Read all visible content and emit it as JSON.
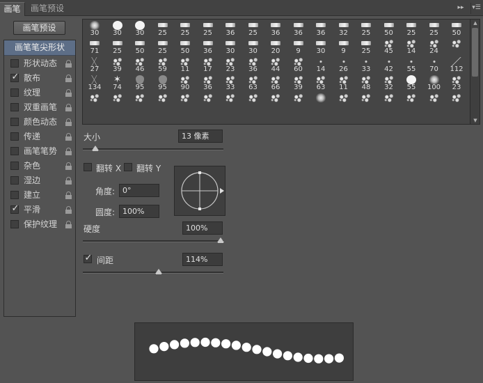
{
  "tabs": [
    {
      "label": "画笔",
      "active": true
    },
    {
      "label": "画笔预设",
      "active": false
    }
  ],
  "panel_controls": {
    "collapse_icon": "double-chevron-right-icon",
    "menu_icon": "panel-menu-icon"
  },
  "preset_button": {
    "label": "画笔预设"
  },
  "sidebar": {
    "header": "画笔笔尖形状",
    "items": [
      {
        "label": "形状动态",
        "checked": false
      },
      {
        "label": "散布",
        "checked": true
      },
      {
        "label": "纹理",
        "checked": false
      },
      {
        "label": "双重画笔",
        "checked": false
      },
      {
        "label": "颜色动态",
        "checked": false
      },
      {
        "label": "传递",
        "checked": false
      },
      {
        "label": "画笔笔势",
        "checked": false
      },
      {
        "label": "杂色",
        "checked": false
      },
      {
        "label": "湿边",
        "checked": false
      },
      {
        "label": "建立",
        "checked": false
      },
      {
        "label": "平滑",
        "checked": true
      },
      {
        "label": "保护纹理",
        "checked": false
      }
    ]
  },
  "brush_grid": {
    "rows": [
      [
        "30",
        "30",
        "30",
        "25",
        "25",
        "25",
        "36",
        "25",
        "36",
        "36",
        "36",
        "32",
        "25",
        "50",
        "25",
        "25",
        "50"
      ],
      [
        "71",
        "25",
        "50",
        "25",
        "50",
        "36",
        "30",
        "30",
        "20",
        "9",
        "30",
        "9",
        "25",
        "45",
        "14",
        "24",
        ""
      ],
      [
        "27",
        "39",
        "46",
        "59",
        "11",
        "17",
        "23",
        "36",
        "44",
        "60",
        "14",
        "26",
        "33",
        "42",
        "55",
        "70",
        "112"
      ],
      [
        "134",
        "74",
        "95",
        "95",
        "90",
        "36",
        "33",
        "63",
        "66",
        "39",
        "63",
        "11",
        "48",
        "32",
        "55",
        "100",
        "23"
      ],
      [
        "",
        "",
        "",
        "",
        "",
        "",
        "",
        "",
        "",
        "",
        "",
        "",
        "",
        "",
        "",
        "",
        ""
      ]
    ],
    "tip_styles": [
      [
        "soft",
        "hard",
        "hard",
        "chisel",
        "chisel",
        "chisel",
        "chisel",
        "chisel",
        "chisel",
        "chisel",
        "chisel",
        "chisel",
        "chisel",
        "chisel",
        "chisel",
        "chisel",
        "chisel"
      ],
      [
        "chisel",
        "chisel",
        "chisel",
        "chisel",
        "chisel",
        "chisel",
        "chisel",
        "chisel",
        "chisel",
        "chisel",
        "chisel",
        "chisel",
        "chisel",
        "spatter",
        "spatter",
        "spatter",
        "spatter"
      ],
      [
        "grass",
        "spatter",
        "spatter",
        "spatter",
        "spatter",
        "spatter",
        "spatter",
        "spatter",
        "spatter",
        "spatter",
        "dot",
        "dot",
        "dot",
        "dot",
        "dot",
        "dot",
        "stroke"
      ],
      [
        "grass",
        "star",
        "leaf",
        "leaf",
        "spatter",
        "spatter",
        "spatter",
        "spatter",
        "spatter",
        "spatter",
        "spatter",
        "spatter",
        "spatter",
        "spatter",
        "hard",
        "soft",
        "spatter"
      ],
      [
        "spatter",
        "spatter",
        "spatter",
        "spatter",
        "spatter",
        "spatter",
        "spatter",
        "spatter",
        "spatter",
        "spatter",
        "soft",
        "spatter",
        "spatter",
        "spatter",
        "spatter",
        "spatter",
        "spatter"
      ]
    ]
  },
  "size": {
    "label": "大小",
    "value": "13 像素",
    "slider_fraction": 0.05
  },
  "flip_x": {
    "label": "翻转 X",
    "checked": false
  },
  "flip_y": {
    "label": "翻转 Y",
    "checked": false
  },
  "angle": {
    "label": "角度:",
    "value": "0°"
  },
  "roundness": {
    "label": "圆度:",
    "value": "100%"
  },
  "hardness": {
    "label": "硬度",
    "value": "100%",
    "slider_fraction": 1.0
  },
  "spacing": {
    "label": "间距",
    "value": "114%",
    "checked": true,
    "slider_fraction": 0.53
  },
  "colors": {
    "panel": "#535353",
    "header_blue": "#5d6e87",
    "field": "#3c3c3c"
  }
}
